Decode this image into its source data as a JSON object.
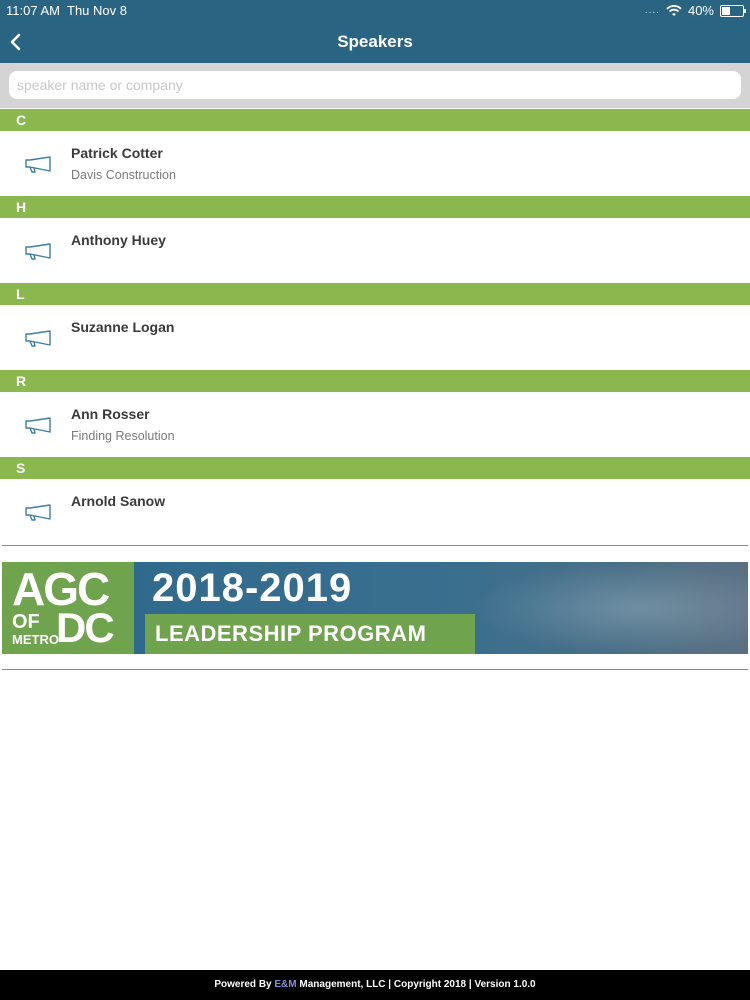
{
  "status_bar": {
    "time": "11:07 AM",
    "date": "Thu Nov 8",
    "battery": "40%",
    "dots": "...."
  },
  "nav": {
    "title": "Speakers"
  },
  "search": {
    "placeholder": "speaker name or company",
    "value": ""
  },
  "sections": [
    {
      "letter": "C",
      "speakers": [
        {
          "name": "Patrick Cotter",
          "company": "Davis Construction"
        }
      ]
    },
    {
      "letter": "H",
      "speakers": [
        {
          "name": "Anthony Huey",
          "company": ""
        }
      ]
    },
    {
      "letter": "L",
      "speakers": [
        {
          "name": "Suzanne Logan",
          "company": ""
        }
      ]
    },
    {
      "letter": "R",
      "speakers": [
        {
          "name": "Ann Rosser",
          "company": "Finding Resolution"
        }
      ]
    },
    {
      "letter": "S",
      "speakers": [
        {
          "name": "Arnold Sanow",
          "company": ""
        }
      ]
    }
  ],
  "banner": {
    "logo_agc": "AGC",
    "logo_of": "OF",
    "logo_metro": "METRO",
    "logo_dc": "DC",
    "year": "2018-2019",
    "program": "LEADERSHIP PROGRAM"
  },
  "footer": {
    "powered_by": "Powered By ",
    "company_accent": "E&M",
    "rest": " Management, LLC | Copyright 2018 | Version 1.0.0"
  },
  "colors": {
    "header": "#2a6483",
    "section_header": "#8bb84e",
    "footer": "#000000"
  },
  "icons": {
    "back": "chevron-left-icon",
    "row": "megaphone-icon"
  }
}
